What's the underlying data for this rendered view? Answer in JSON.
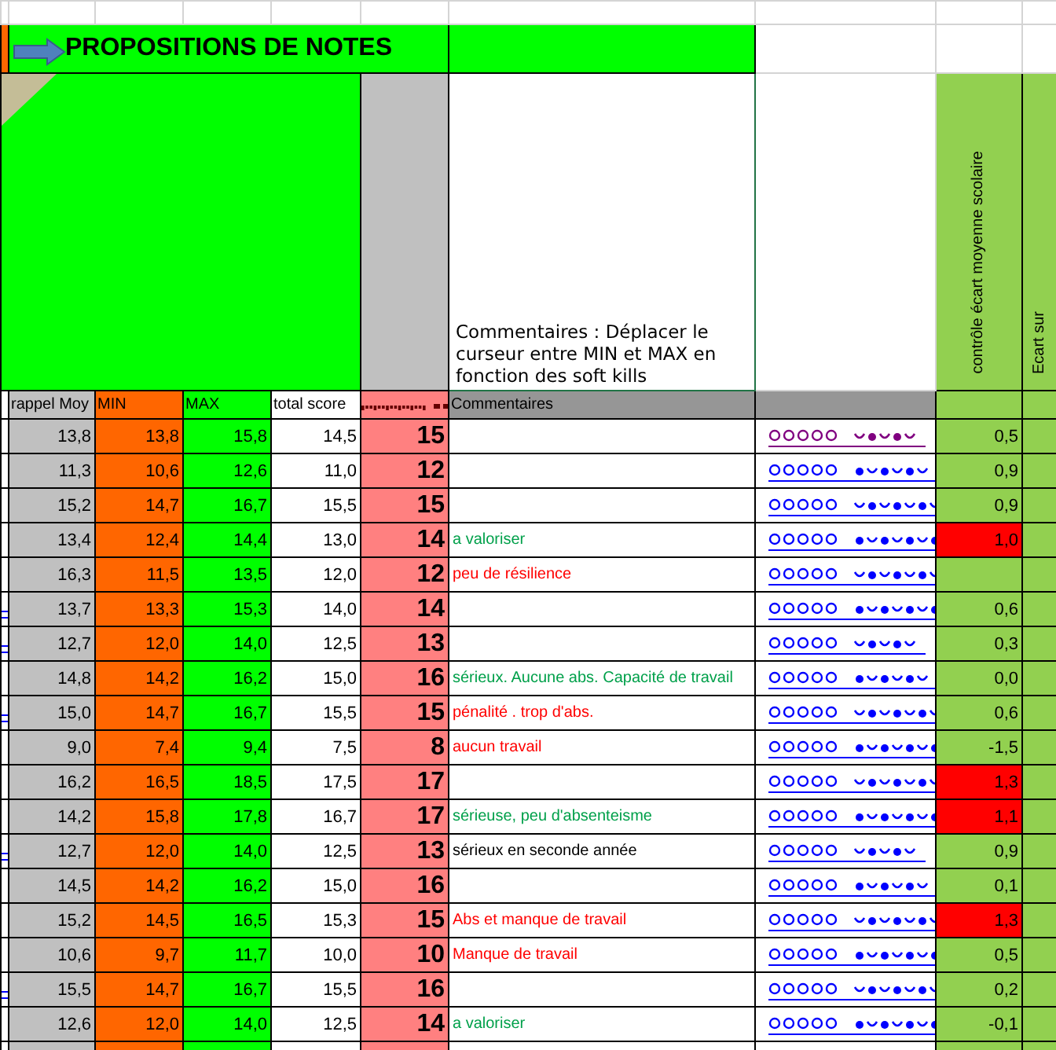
{
  "title": "PROPOSITIONS DE NOTES",
  "instructions": "Commentaires : Déplacer le curseur entre MIN et MAX en fonction des soft kills",
  "vertical_headers": [
    "contrôle écart moyenne scolaire",
    "Ecart sur"
  ],
  "columns": [
    "rappel Moy",
    "MIN",
    "MAX",
    "total score",
    "Commentaires"
  ],
  "rows": [
    {
      "left_link": false,
      "rappel": "13,8",
      "min": "13,8",
      "max": "15,8",
      "total": "14,5",
      "note": "15",
      "link_visited": true,
      "ecart": "0,5",
      "flagged": false
    },
    {
      "left_link": false,
      "rappel": "11,3",
      "min": "10,6",
      "max": "12,6",
      "total": "11,0",
      "note": "12",
      "link_visited": false,
      "ecart": "0,9",
      "flagged": false
    },
    {
      "left_link": false,
      "rappel": "15,2",
      "min": "14,7",
      "max": "16,7",
      "total": "15,5",
      "note": "15",
      "link_visited": false,
      "ecart": "0,9",
      "flagged": false
    },
    {
      "left_link": false,
      "rappel": "13,4",
      "min": "12,4",
      "max": "14,4",
      "total": "13,0",
      "note": "14",
      "comment": {
        "text": " a valoriser",
        "color": "#00a04a"
      },
      "link_visited": false,
      "ecart": "1,0",
      "flagged": true
    },
    {
      "left_link": false,
      "rappel": "16,3",
      "min": "11,5",
      "max": "13,5",
      "total": "12,0",
      "note": "12",
      "comment": {
        "text": "peu de résilience",
        "color": "#ff0000"
      },
      "link_visited": false,
      "flagged": false
    },
    {
      "left_link": true,
      "rappel": "13,7",
      "min": "13,3",
      "max": "15,3",
      "total": "14,0",
      "note": "14",
      "link_visited": false,
      "ecart": "0,6",
      "flagged": false
    },
    {
      "left_link": true,
      "rappel": "12,7",
      "min": "12,0",
      "max": "14,0",
      "total": "12,5",
      "note": "13",
      "link_visited": false,
      "ecart": "0,3",
      "flagged": false
    },
    {
      "left_link": false,
      "rappel": "14,8",
      "min": "14,2",
      "max": "16,2",
      "total": "15,0",
      "note": "16",
      "comment": {
        "text": "sérieux. Aucune abs. Capacité de travail",
        "color": "#00a04a"
      },
      "link_visited": false,
      "ecart": "0,0",
      "flagged": false
    },
    {
      "left_link": true,
      "rappel": "15,0",
      "min": "14,7",
      "max": "16,7",
      "total": "15,5",
      "note": "15",
      "comment": {
        "text": "pénalité . trop d'abs.",
        "color": "#ff0000"
      },
      "link_visited": false,
      "ecart": "0,6",
      "flagged": false
    },
    {
      "left_link": false,
      "rappel": "9,0",
      "min": "7,4",
      "max": "9,4",
      "total": "7,5",
      "note": "8",
      "comment": {
        "text": "aucun travail",
        "color": "#ff0000"
      },
      "link_visited": false,
      "ecart": "-1,5",
      "flagged": false
    },
    {
      "left_link": false,
      "rappel": "16,2",
      "min": "16,5",
      "max": "18,5",
      "total": "17,5",
      "note": "17",
      "link_visited": false,
      "ecart": "1,3",
      "flagged": true
    },
    {
      "left_link": false,
      "rappel": "14,2",
      "min": "15,8",
      "max": "17,8",
      "total": "16,7",
      "note": "17",
      "comment": {
        "text": "sérieuse, peu d'absenteisme",
        "color": "#00a04a"
      },
      "link_visited": false,
      "ecart": "1,1",
      "flagged": true
    },
    {
      "left_link": true,
      "rappel": "12,7",
      "min": "12,0",
      "max": "14,0",
      "total": "12,5",
      "note": "13",
      "comment": {
        "text": "sérieux en seconde année",
        "color": "#000000"
      },
      "link_visited": false,
      "ecart": "0,9",
      "flagged": false
    },
    {
      "left_link": false,
      "rappel": "14,5",
      "min": "14,2",
      "max": "16,2",
      "total": "15,0",
      "note": "16",
      "link_visited": false,
      "ecart": "0,1",
      "flagged": false
    },
    {
      "left_link": false,
      "rappel": "15,2",
      "min": "14,5",
      "max": "16,5",
      "total": "15,3",
      "note": "15",
      "comment": {
        "text": "Abs et manque de travail",
        "color": "#ff0000"
      },
      "link_visited": false,
      "ecart": "1,3",
      "flagged": true
    },
    {
      "left_link": false,
      "rappel": "10,6",
      "min": "9,7",
      "max": "11,7",
      "total": "10,0",
      "note": "10",
      "comment": {
        "text": "Manque de travail",
        "color": "#ff0000"
      },
      "link_visited": false,
      "ecart": "0,5",
      "flagged": false
    },
    {
      "left_link": true,
      "rappel": "15,5",
      "min": "14,7",
      "max": "16,7",
      "total": "15,5",
      "note": "16",
      "link_visited": false,
      "ecart": "0,2",
      "flagged": false
    },
    {
      "left_link": false,
      "rappel": "12,6",
      "min": "12,0",
      "max": "14,0",
      "total": "12,5",
      "note": "14",
      "comment": {
        "text": " a valoriser",
        "color": "#00a04a"
      },
      "link_visited": false,
      "ecart": "-0,1",
      "flagged": false
    }
  ]
}
